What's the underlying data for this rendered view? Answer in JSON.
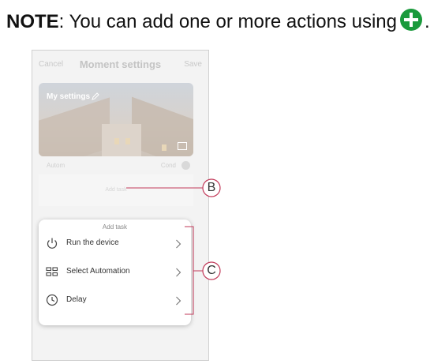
{
  "note": {
    "bold_prefix": "NOTE",
    "text": ": You can add one or more actions using",
    "period": ".",
    "icon": "green-plus-circle",
    "icon_color": "#1a9a3c"
  },
  "topbar": {
    "cancel_label": "Cancel",
    "title": "Moment settings",
    "save_label": "Save"
  },
  "card": {
    "name": "My settings"
  },
  "auto_row": {
    "label": "Autom",
    "value": "Cond"
  },
  "auto_box": {
    "faint_text": "Add task"
  },
  "sheet": {
    "title": "Add task",
    "items": [
      {
        "label": "Run the device",
        "icon": "power-icon"
      },
      {
        "label": "Select Automation",
        "icon": "automation-grid-icon"
      },
      {
        "label": "Delay",
        "icon": "clock-icon"
      }
    ]
  },
  "callouts": {
    "b": "B",
    "c": "C",
    "color": "#c23a5a"
  }
}
